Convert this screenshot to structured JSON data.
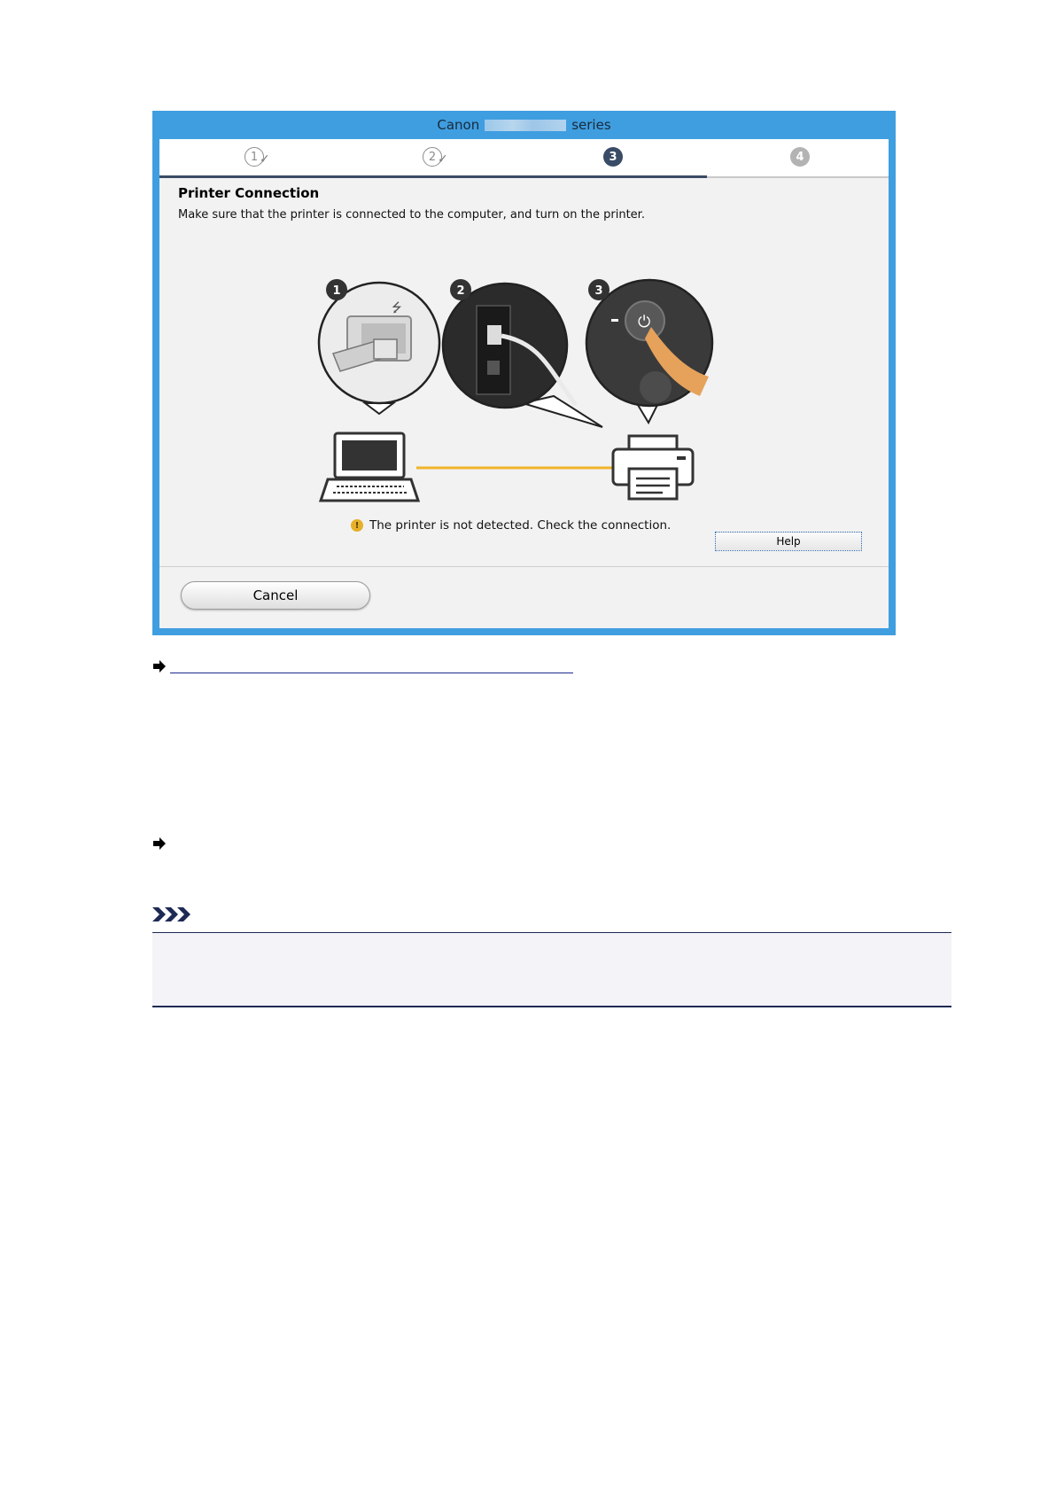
{
  "dialog": {
    "title_prefix": "Canon",
    "title_suffix": "series",
    "steps": [
      {
        "label": "1",
        "state": "done"
      },
      {
        "label": "2",
        "state": "done"
      },
      {
        "label": "3",
        "state": "active"
      },
      {
        "label": "4",
        "state": "pending"
      }
    ],
    "heading": "Printer Connection",
    "instruction": "Make sure that the printer is connected to the computer, and turn on the printer.",
    "illustration": {
      "callouts": [
        "1",
        "2",
        "3"
      ],
      "cable_color": "#f0b429"
    },
    "status_message": "The printer is not detected. Check the connection.",
    "help_label": "Help",
    "cancel_label": "Cancel"
  },
  "colors": {
    "frame": "#3f9ee0",
    "step_active": "#3a4b66",
    "warning": "#e5b02a",
    "link": "#1b2a8c"
  }
}
